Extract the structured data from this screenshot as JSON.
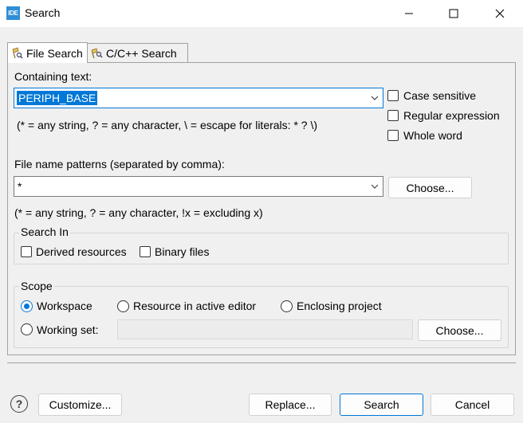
{
  "window": {
    "title": "Search",
    "app_icon_text": "IDE"
  },
  "tabs": [
    {
      "label": "File Search",
      "active": true
    },
    {
      "label": "C/C++ Search",
      "active": false
    }
  ],
  "containing": {
    "label": "Containing text:",
    "value": "PERIPH_BASE",
    "hint": "(* = any string, ? = any character, \\ = escape for literals: * ? \\)",
    "options": [
      {
        "label": "Case sensitive",
        "checked": false
      },
      {
        "label": "Regular expression",
        "checked": false
      },
      {
        "label": "Whole word",
        "checked": false
      }
    ]
  },
  "file_patterns": {
    "label": "File name patterns (separated by comma):",
    "value": "*",
    "choose_label": "Choose...",
    "hint": "(* = any string, ? = any character, !x = excluding x)"
  },
  "search_in": {
    "title": "Search In",
    "options": [
      {
        "label": "Derived resources",
        "checked": false
      },
      {
        "label": "Binary files",
        "checked": false
      }
    ]
  },
  "scope": {
    "title": "Scope",
    "options": [
      {
        "label": "Workspace",
        "checked": true
      },
      {
        "label": "Resource in active editor",
        "checked": false
      },
      {
        "label": "Enclosing project",
        "checked": false
      },
      {
        "label": "Working set:",
        "checked": false
      }
    ],
    "working_set_value": "",
    "choose_label": "Choose..."
  },
  "footer": {
    "help_symbol": "?",
    "customize_label": "Customize...",
    "replace_label": "Replace...",
    "search_label": "Search",
    "cancel_label": "Cancel"
  },
  "colors": {
    "accent": "#0078d7",
    "background": "#f0f0f0",
    "app_icon": "#2e8ed6"
  },
  "icons": [
    "file-search-icon",
    "cpp-search-icon",
    "minimize-icon",
    "maximize-icon",
    "close-icon",
    "dropdown-arrow-icon",
    "help-icon"
  ]
}
